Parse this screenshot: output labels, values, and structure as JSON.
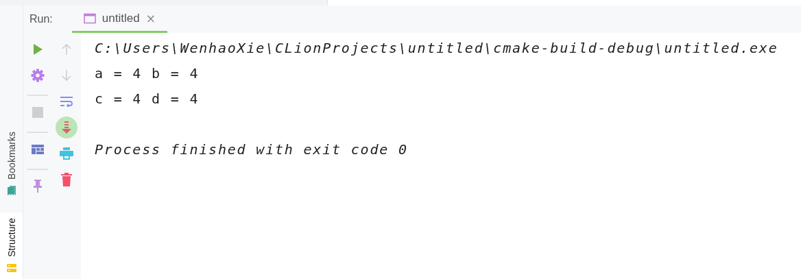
{
  "run_panel": {
    "label": "Run:",
    "tabs": [
      {
        "label": "untitled",
        "close": "×",
        "selected": true
      }
    ]
  },
  "side_tabs": [
    {
      "label": "Bookmarks",
      "kind": "bookmarks",
      "selected": false
    },
    {
      "label": "Structure",
      "kind": "structure",
      "selected": true
    }
  ],
  "toolbar_left": [
    {
      "kind": "run",
      "disabled": false
    },
    {
      "kind": "settings",
      "disabled": false
    },
    {
      "kind": "divider"
    },
    {
      "kind": "stop",
      "disabled": true
    },
    {
      "kind": "divider"
    },
    {
      "kind": "layout",
      "disabled": false
    },
    {
      "kind": "divider"
    },
    {
      "kind": "pin",
      "disabled": false
    }
  ],
  "toolbar_right": [
    {
      "kind": "up",
      "disabled": true,
      "on": false
    },
    {
      "kind": "down",
      "disabled": true,
      "on": false
    },
    {
      "kind": "wrap",
      "disabled": false,
      "on": false
    },
    {
      "kind": "scroll-end",
      "disabled": false,
      "on": true
    },
    {
      "kind": "print",
      "disabled": false,
      "on": false
    },
    {
      "kind": "trash",
      "disabled": false,
      "on": false
    }
  ],
  "console": [
    {
      "text": "C:\\Users\\WenhaoXie\\CLionProjects\\untitled\\cmake-build-debug\\untitled.exe",
      "kind": "italic"
    },
    {
      "text": "a = 4 b = 4",
      "kind": "normal"
    },
    {
      "text": "c = 4 d = 4",
      "kind": "normal"
    },
    {
      "kind": "blank"
    },
    {
      "text": "Process finished with exit code 0",
      "kind": "italic"
    }
  ]
}
